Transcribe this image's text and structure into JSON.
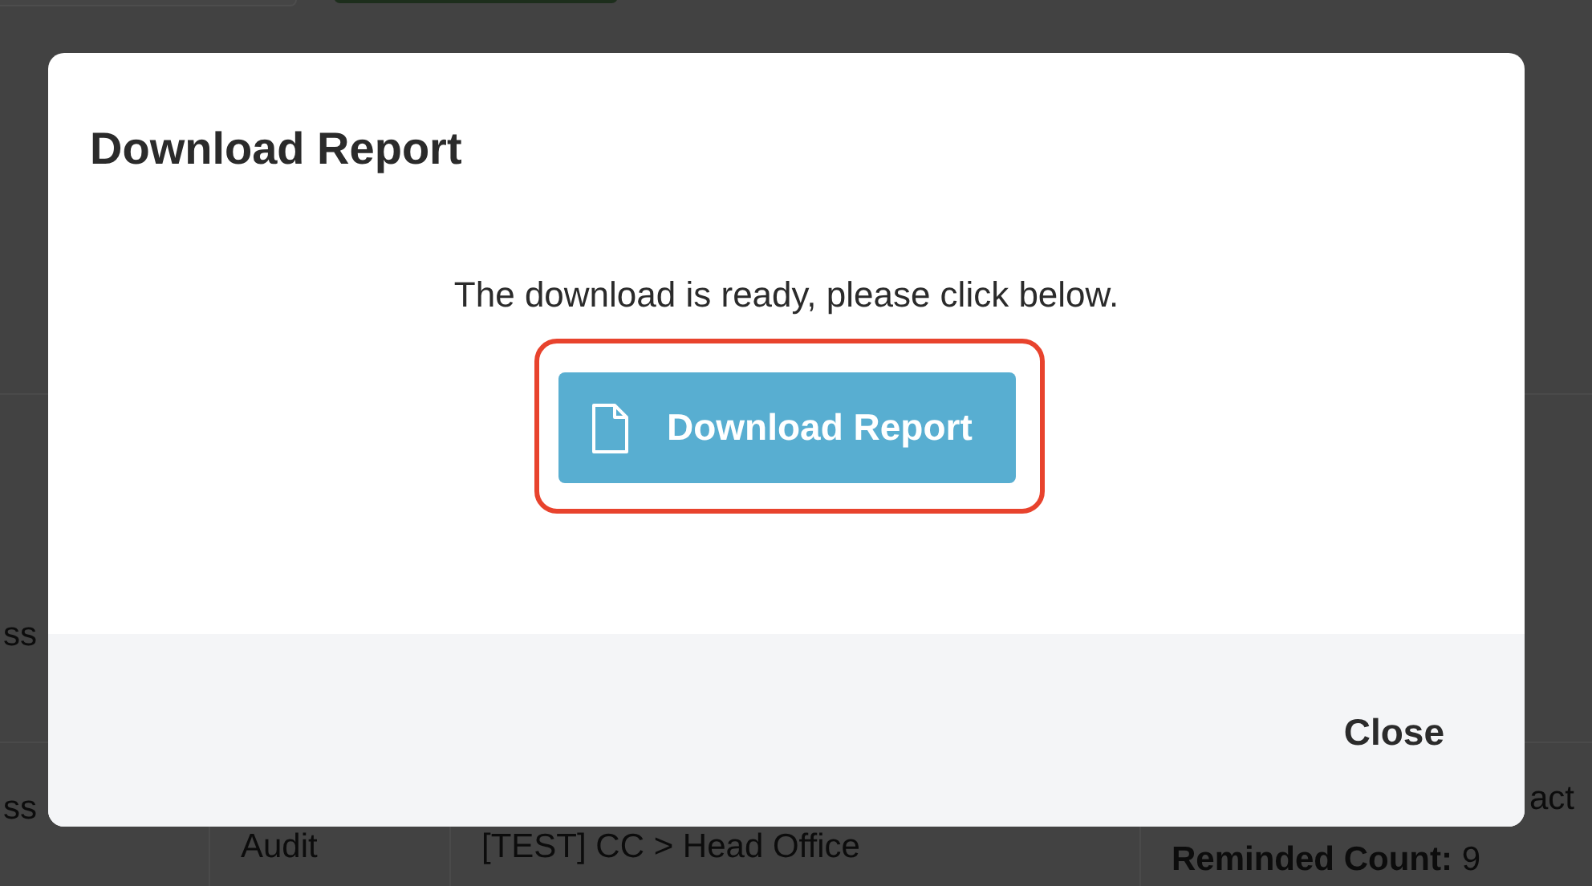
{
  "background": {
    "texts": [
      {
        "text": "ss"
      },
      {
        "text": "ss"
      },
      {
        "text": "Audit"
      },
      {
        "text": "[TEST] CC > Head Office"
      },
      {
        "text": "act"
      },
      {
        "text": "**Reminded Count:** 9"
      }
    ]
  },
  "modal": {
    "title": "Download Report",
    "message": "The download is ready, please click below.",
    "download_button": {
      "label": "Download Report",
      "highlighted": true
    },
    "close_button": {
      "label": "Close"
    }
  }
}
